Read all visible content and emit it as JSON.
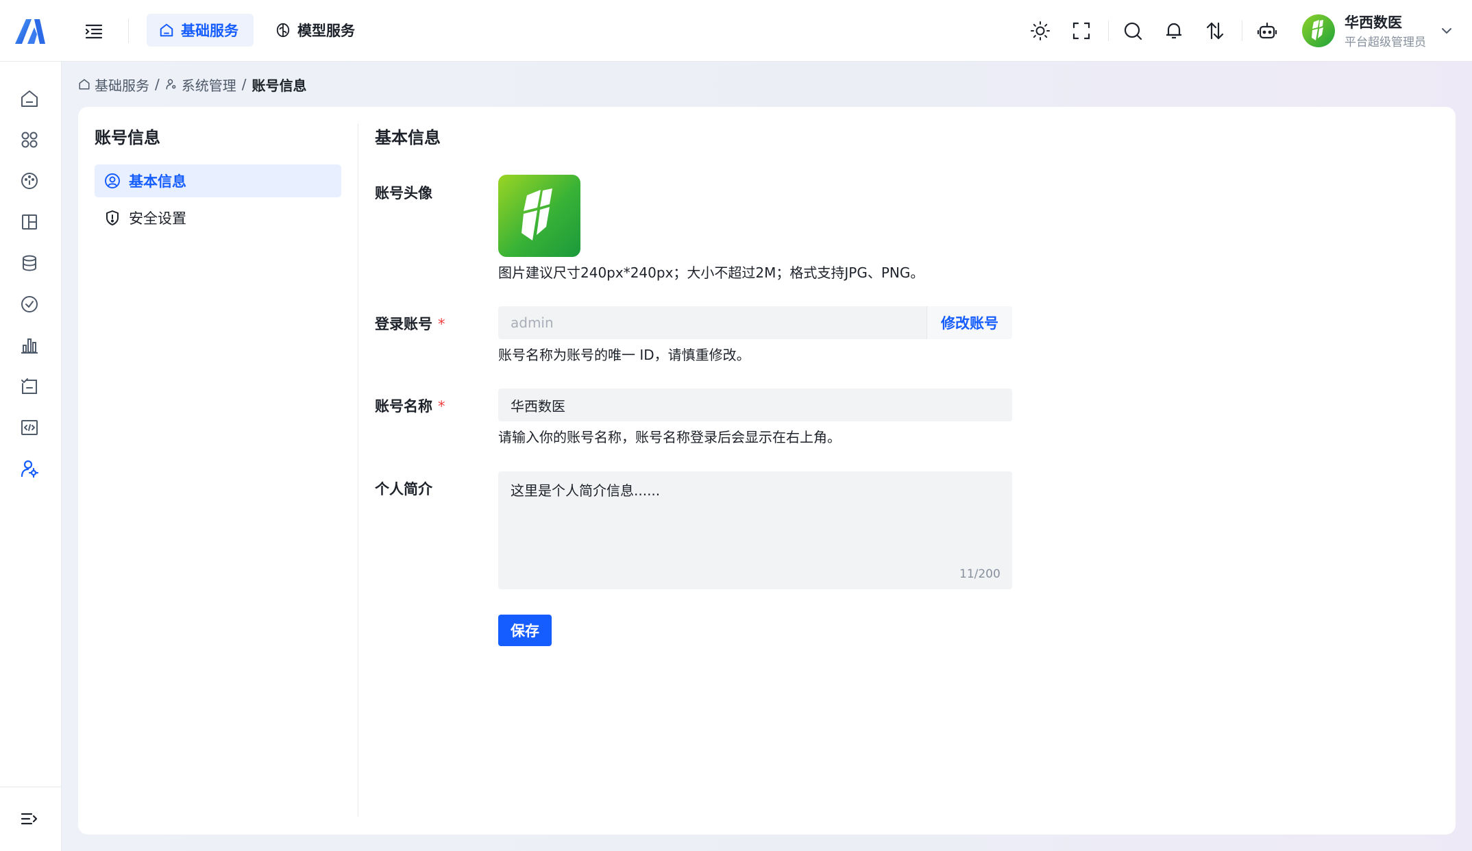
{
  "header": {
    "nav": [
      {
        "label": "基础服务",
        "icon": "home-icon",
        "active": true
      },
      {
        "label": "模型服务",
        "icon": "brain-icon",
        "active": false
      }
    ],
    "toolbar_icons": [
      "sun-icon",
      "fullscreen-icon",
      "search-icon",
      "bell-icon",
      "transfer-icon",
      "robot-icon"
    ],
    "user": {
      "name": "华西数医",
      "role": "平台超级管理员"
    }
  },
  "sidebar": {
    "icons": [
      "home-icon",
      "apps-icon",
      "dashboard-icon",
      "layout-icon",
      "database-icon",
      "check-circle-icon",
      "bar-chart-icon",
      "task-icon",
      "code-icon",
      "user-settings-icon"
    ],
    "active_index": 9
  },
  "breadcrumb": [
    "基础服务",
    "/",
    "系统管理",
    "/",
    "账号信息"
  ],
  "panel": {
    "title": "账号信息",
    "menu": [
      {
        "label": "基本信息",
        "icon": "user-circle-icon",
        "active": true
      },
      {
        "label": "安全设置",
        "icon": "shield-icon",
        "active": false
      }
    ]
  },
  "form": {
    "section_title": "基本信息",
    "avatar": {
      "label": "账号头像",
      "help": "图片建议尺寸240px*240px；大小不超过2M；格式支持JPG、PNG。"
    },
    "login": {
      "label": "登录账号",
      "required_mark": "*",
      "value": "admin",
      "modify_label": "修改账号",
      "help": "账号名称为账号的唯一 ID，请慎重修改。"
    },
    "name": {
      "label": "账号名称",
      "required_mark": "*",
      "value": "华西数医",
      "help": "请输入你的账号名称，账号名称登录后会显示在右上角。"
    },
    "bio": {
      "label": "个人简介",
      "value": "这里是个人简介信息......",
      "counter": "11/200"
    },
    "save_label": "保存"
  },
  "colors": {
    "primary": "#165dff",
    "required": "#f53f3f",
    "brand_green": "#39b236"
  }
}
